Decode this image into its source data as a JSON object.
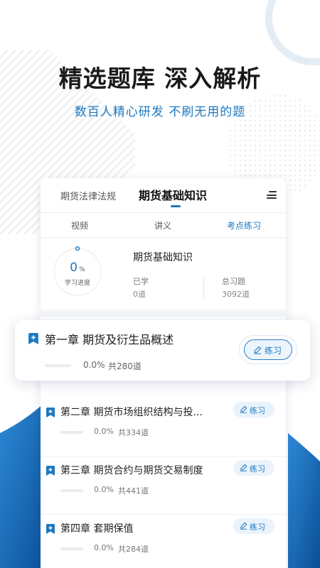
{
  "header": {
    "title": "精选题库  深入解析",
    "subtitle": "数百人精心研发  不刷无用的题"
  },
  "colors": {
    "accent": "#1c78c0",
    "accent_dark": "#0d57a0",
    "text_primary": "#222222",
    "text_secondary": "#777777"
  },
  "tabs": {
    "items": [
      {
        "label": "期货法律法规",
        "active": false
      },
      {
        "label": "期货基础知识",
        "active": true
      }
    ],
    "menu_icon": "menu-icon"
  },
  "subtabs": {
    "items": [
      {
        "label": "视频",
        "active": false
      },
      {
        "label": "讲义",
        "active": false
      },
      {
        "label": "考点练习",
        "active": true
      }
    ]
  },
  "summary": {
    "progress_value": "0",
    "progress_unit": "%",
    "progress_fraction": 0,
    "progress_label": "学习进度",
    "title": "期货基础知识",
    "learned_label": "已学",
    "learned_value": "0道",
    "total_label": "总习题",
    "total_value": "3092道"
  },
  "chapters": [
    {
      "title": "第一章 期货及衍生品概述",
      "percent": "0.0%",
      "count": "共280道",
      "button": "练习",
      "icon": "bookmark-plus-icon",
      "featured": true
    },
    {
      "title": "第二章 期货市场组织结构与投...",
      "percent": "0.0%",
      "count": "共334道",
      "button": "练习",
      "icon": "bookmark-plus-icon"
    },
    {
      "title": "第三章 期货合约与期货交易制度",
      "percent": "0.0%",
      "count": "共441道",
      "button": "练习",
      "icon": "bookmark-plus-icon"
    },
    {
      "title": "第四章 套期保值",
      "percent": "0.0%",
      "count": "共284道",
      "button": "练习",
      "icon": "bookmark-plus-icon"
    }
  ]
}
